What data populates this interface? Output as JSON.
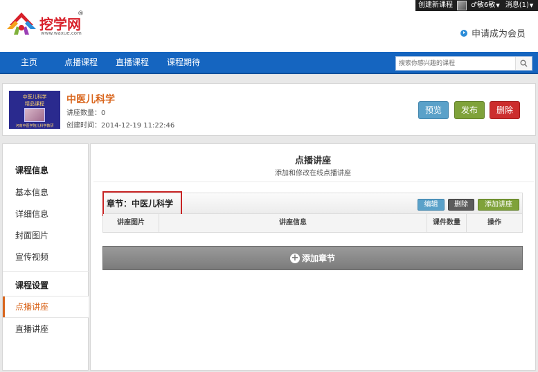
{
  "topbar": {
    "create_course": "创建新课程",
    "user": "♂敏6敏",
    "messages": "消息(1)"
  },
  "header": {
    "logo_text": "挖学网",
    "logo_url": "www.waxue.com",
    "apply_member": "申请成为会员"
  },
  "nav": {
    "items": [
      "主页",
      "点播课程",
      "直播课程",
      "课程期待"
    ],
    "search_placeholder": "搜索你感兴趣的课程"
  },
  "course": {
    "title": "中医儿科学",
    "lecture_count": "讲座数量：0",
    "created_time": "创建时间：2014-12-19 11:22:46",
    "thumb_line1": "中医儿科学",
    "thumb_line2": "精品课程",
    "thumb_line3": "河南中医学院儿科学教研",
    "buttons": {
      "preview": "预览",
      "publish": "发布",
      "delete": "删除"
    }
  },
  "sidebar": {
    "group1": "课程信息",
    "group1_items": [
      "基本信息",
      "详细信息",
      "封面图片",
      "宣传视频"
    ],
    "group2": "课程设置",
    "group2_items": [
      "点播讲座",
      "直播讲座"
    ],
    "active": "点播讲座"
  },
  "main": {
    "title": "点播讲座",
    "subtitle": "添加和修改在线点播讲座",
    "chapter": {
      "name": "章节：中医儿科学",
      "edit": "编辑",
      "delete": "删除",
      "add_lecture": "添加讲座",
      "columns": [
        "讲座图片",
        "讲座信息",
        "课件数量",
        "操作"
      ]
    },
    "add_chapter": "添加章节"
  },
  "colors": {
    "nav_blue": "#1565c0",
    "accent_orange": "#d9651c",
    "delete_red": "#cc2e2e",
    "publish_green": "#7fa23a",
    "preview_blue": "#5aa1c9"
  }
}
